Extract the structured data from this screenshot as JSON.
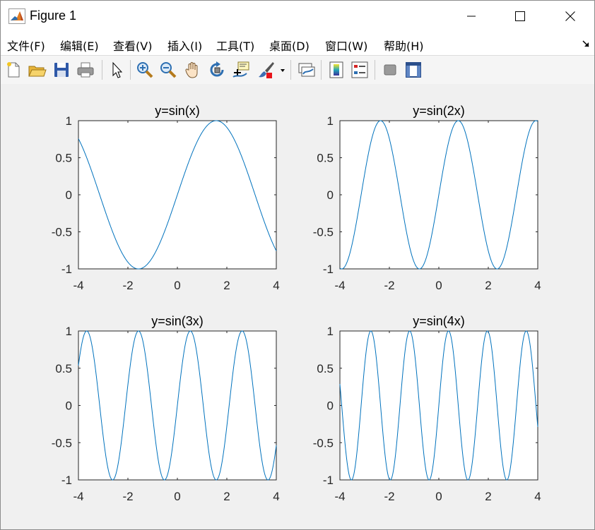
{
  "window": {
    "title": "Figure 1"
  },
  "menu": {
    "items": [
      "文件(F)",
      "编辑(E)",
      "查看(V)",
      "插入(I)",
      "工具(T)",
      "桌面(D)",
      "窗口(W)",
      "帮助(H)"
    ]
  },
  "toolbar": {
    "icons": [
      "new-figure-icon",
      "open-file-icon",
      "save-icon",
      "print-icon",
      "pointer-icon",
      "zoom-in-icon",
      "zoom-out-icon",
      "pan-icon",
      "rotate-3d-icon",
      "data-cursor-icon",
      "brush-icon",
      "brush-dropdown-icon",
      "link-plot-icon",
      "colorbar-icon",
      "legend-icon",
      "hide-plot-tools-icon",
      "show-plot-tools-icon"
    ]
  },
  "colors": {
    "line": "#0072BD",
    "axes_background": "#ffffff",
    "figure_background": "#f0f0f0"
  },
  "chart_data": [
    {
      "type": "line",
      "title": "y=sin(x)",
      "function": "sin(x)",
      "frequency": 1,
      "xlim": [
        -4,
        4
      ],
      "ylim": [
        -1,
        1
      ],
      "xticks": [
        -4,
        -2,
        0,
        2,
        4
      ],
      "yticks": [
        -1,
        -0.5,
        0,
        0.5,
        1
      ],
      "xtick_labels": [
        "-4",
        "-2",
        "0",
        "2",
        "4"
      ],
      "ytick_labels": [
        "-1",
        "-0.5",
        "0",
        "0.5",
        "1"
      ],
      "grid": false
    },
    {
      "type": "line",
      "title": "y=sin(2x)",
      "function": "sin(2x)",
      "frequency": 2,
      "xlim": [
        -4,
        4
      ],
      "ylim": [
        -1,
        1
      ],
      "xticks": [
        -4,
        -2,
        0,
        2,
        4
      ],
      "yticks": [
        -1,
        -0.5,
        0,
        0.5,
        1
      ],
      "xtick_labels": [
        "-4",
        "-2",
        "0",
        "2",
        "4"
      ],
      "ytick_labels": [
        "-1",
        "-0.5",
        "0",
        "0.5",
        "1"
      ],
      "grid": false
    },
    {
      "type": "line",
      "title": "y=sin(3x)",
      "function": "sin(3x)",
      "frequency": 3,
      "xlim": [
        -4,
        4
      ],
      "ylim": [
        -1,
        1
      ],
      "xticks": [
        -4,
        -2,
        0,
        2,
        4
      ],
      "yticks": [
        -1,
        -0.5,
        0,
        0.5,
        1
      ],
      "xtick_labels": [
        "-4",
        "-2",
        "0",
        "2",
        "4"
      ],
      "ytick_labels": [
        "-1",
        "-0.5",
        "0",
        "0.5",
        "1"
      ],
      "grid": false
    },
    {
      "type": "line",
      "title": "y=sin(4x)",
      "function": "sin(4x)",
      "frequency": 4,
      "xlim": [
        -4,
        4
      ],
      "ylim": [
        -1,
        1
      ],
      "xticks": [
        -4,
        -2,
        0,
        2,
        4
      ],
      "yticks": [
        -1,
        -0.5,
        0,
        0.5,
        1
      ],
      "xtick_labels": [
        "-4",
        "-2",
        "0",
        "2",
        "4"
      ],
      "ytick_labels": [
        "-1",
        "-0.5",
        "0",
        "0.5",
        "1"
      ],
      "grid": false
    }
  ]
}
